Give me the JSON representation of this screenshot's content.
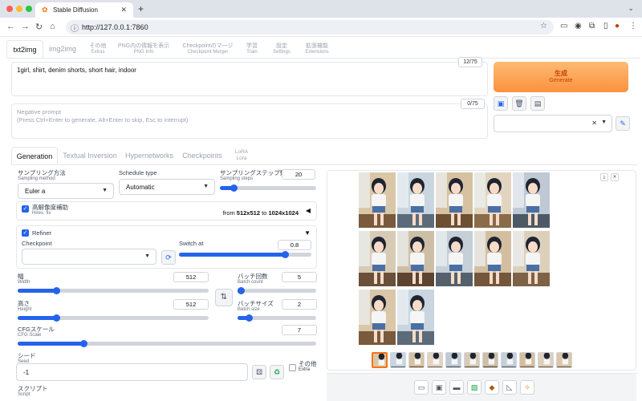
{
  "browser": {
    "tab_title": "Stable Diffusion",
    "url": "http://127.0.0.1:7860"
  },
  "app_tabs": [
    {
      "main": "txt2img",
      "sub": ""
    },
    {
      "main": "img2img",
      "sub": ""
    },
    {
      "main": "その他",
      "sub": "Extras"
    },
    {
      "main": "PNG内の情報を表示",
      "sub": "PNG Info"
    },
    {
      "main": "Checkpointのマージ",
      "sub": "Checkpoint Merger"
    },
    {
      "main": "学習",
      "sub": "Train"
    },
    {
      "main": "設定",
      "sub": "Settings"
    },
    {
      "main": "拡張機能",
      "sub": "Extensions"
    }
  ],
  "prompt": {
    "value": "1girl,  shirt,  denim shorts,  short hair,  indoor",
    "token_count": "12/75"
  },
  "negative_prompt": {
    "placeholder_line1": "Negative prompt",
    "placeholder_line2": "(Press Ctrl+Enter to generate, Alt+Enter to skip, Esc to interrupt)",
    "token_count": "0/75"
  },
  "generate": {
    "main": "生成",
    "sub": "Generate"
  },
  "tool_icons": [
    "save-style-icon",
    "trash-icon",
    "clipboard-icon",
    "edit-icon"
  ],
  "sub_tabs": [
    {
      "main": "Generation",
      "sub": ""
    },
    {
      "main": "Textual Inversion",
      "sub": ""
    },
    {
      "main": "Hypernetworks",
      "sub": ""
    },
    {
      "main": "Checkpoints",
      "sub": ""
    },
    {
      "main": "LoRA",
      "sub": "Lora"
    }
  ],
  "sampling_method": {
    "label": "サンプリング方法",
    "sub": "Sampling method",
    "value": "Euler a"
  },
  "schedule_type": {
    "label": "Schedule type",
    "value": "Automatic"
  },
  "sampling_steps": {
    "label": "サンプリングステップ数",
    "sub": "Sampling steps",
    "value": "20",
    "fraction": 0.14
  },
  "hires_fix": {
    "label": "高解像度補助",
    "sub": "Hires. fix",
    "from_label": "from",
    "from_value": "512x512",
    "to_label": "to",
    "to_value": "1024x1024"
  },
  "refiner": {
    "label": "Refiner",
    "checkpoint_label": "Checkpoint",
    "switch_label": "Switch at",
    "switch_value": "0.8",
    "fraction": 0.8
  },
  "width": {
    "label": "幅",
    "sub": "Width",
    "value": "512",
    "fraction": 0.2
  },
  "height": {
    "label": "高さ",
    "sub": "Height",
    "value": "512",
    "fraction": 0.2
  },
  "batch_count": {
    "label": "バッチ回数",
    "sub": "Batch count",
    "value": "5",
    "fraction": 0.04
  },
  "batch_size": {
    "label": "バッチサイズ",
    "sub": "Batch size",
    "value": "2",
    "fraction": 0.14
  },
  "cfg_scale": {
    "label": "CFGスケール",
    "sub": "CFG Scale",
    "value": "7",
    "fraction": 0.22
  },
  "seed": {
    "label": "シード",
    "sub": "Seed",
    "value": "-1"
  },
  "extra": {
    "main": "その他",
    "sub": "Extra"
  },
  "script": {
    "label": "スクリプト",
    "sub": "Script"
  },
  "colors": {
    "accent": "#2563eb",
    "generate": "#fb923c",
    "selected_thumb": "#f97316"
  }
}
